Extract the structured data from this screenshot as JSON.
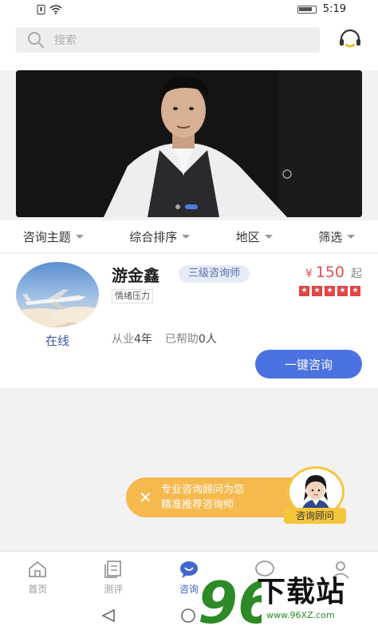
{
  "status_bar": {
    "time": "5:19",
    "signal_icon": "sim-icon",
    "wifi_icon": "wifi-icon",
    "battery_icon": "battery-icon"
  },
  "header": {
    "search_placeholder": "搜索",
    "support_icon": "headset-icon"
  },
  "banner": {
    "slide_count": 2,
    "active_slide": 2
  },
  "filters": [
    {
      "label": "咨询主题"
    },
    {
      "label": "综合排序"
    },
    {
      "label": "地区"
    },
    {
      "label": "筛选"
    }
  ],
  "counselor": {
    "name": "游金鑫",
    "level": "三级咨询师",
    "tag": "情绪压力",
    "price_currency": "¥",
    "price": "150",
    "price_suffix": "起",
    "rating": 5,
    "status": "在线",
    "years_label": "从业",
    "years": "4年",
    "helped_label": "已帮助",
    "helped": "0人",
    "consult_button": "一键咨询"
  },
  "float_prompt": {
    "line1": "专业咨询顾问为您",
    "line2": "精准推荐咨询师",
    "close_icon": "close-icon",
    "advisor_label": "咨询顾问"
  },
  "tabs": [
    {
      "label": "首页",
      "icon": "home-icon"
    },
    {
      "label": "测评",
      "icon": "test-icon"
    },
    {
      "label": "咨询",
      "icon": "consult-icon",
      "active": true
    },
    {
      "label": "",
      "icon": "message-icon"
    },
    {
      "label": "",
      "icon": "profile-icon"
    }
  ],
  "watermark": {
    "number": "96",
    "title": "下载站",
    "url": "www.96XZ.com"
  },
  "colors": {
    "accent": "#4a72e0",
    "price": "#e25050",
    "badge_bg": "#e6ebf7",
    "float_bg": "#f5b94e",
    "advisor_ring": "#f5c63c",
    "watermark_green": "#2d8a26"
  }
}
